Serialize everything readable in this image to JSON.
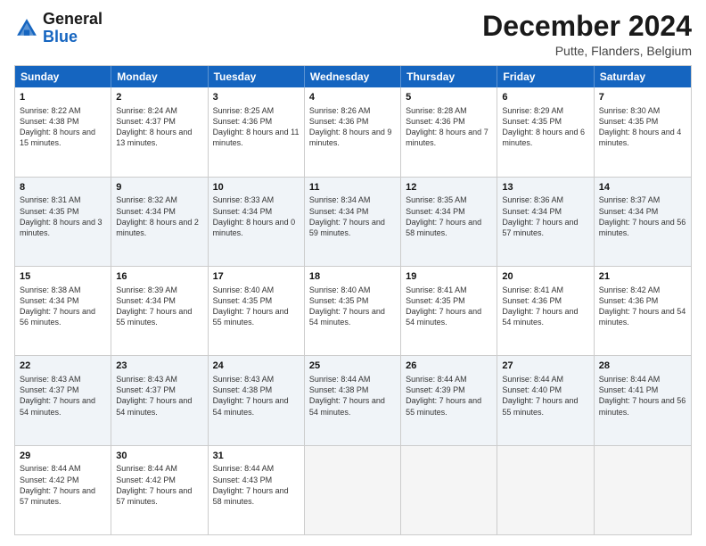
{
  "header": {
    "logo": {
      "line1": "General",
      "line2": "Blue"
    },
    "title": "December 2024",
    "subtitle": "Putte, Flanders, Belgium"
  },
  "calendar": {
    "days": [
      "Sunday",
      "Monday",
      "Tuesday",
      "Wednesday",
      "Thursday",
      "Friday",
      "Saturday"
    ],
    "rows": [
      [
        {
          "day": "1",
          "sunrise": "Sunrise: 8:22 AM",
          "sunset": "Sunset: 4:38 PM",
          "daylight": "Daylight: 8 hours and 15 minutes."
        },
        {
          "day": "2",
          "sunrise": "Sunrise: 8:24 AM",
          "sunset": "Sunset: 4:37 PM",
          "daylight": "Daylight: 8 hours and 13 minutes."
        },
        {
          "day": "3",
          "sunrise": "Sunrise: 8:25 AM",
          "sunset": "Sunset: 4:36 PM",
          "daylight": "Daylight: 8 hours and 11 minutes."
        },
        {
          "day": "4",
          "sunrise": "Sunrise: 8:26 AM",
          "sunset": "Sunset: 4:36 PM",
          "daylight": "Daylight: 8 hours and 9 minutes."
        },
        {
          "day": "5",
          "sunrise": "Sunrise: 8:28 AM",
          "sunset": "Sunset: 4:36 PM",
          "daylight": "Daylight: 8 hours and 7 minutes."
        },
        {
          "day": "6",
          "sunrise": "Sunrise: 8:29 AM",
          "sunset": "Sunset: 4:35 PM",
          "daylight": "Daylight: 8 hours and 6 minutes."
        },
        {
          "day": "7",
          "sunrise": "Sunrise: 8:30 AM",
          "sunset": "Sunset: 4:35 PM",
          "daylight": "Daylight: 8 hours and 4 minutes."
        }
      ],
      [
        {
          "day": "8",
          "sunrise": "Sunrise: 8:31 AM",
          "sunset": "Sunset: 4:35 PM",
          "daylight": "Daylight: 8 hours and 3 minutes."
        },
        {
          "day": "9",
          "sunrise": "Sunrise: 8:32 AM",
          "sunset": "Sunset: 4:34 PM",
          "daylight": "Daylight: 8 hours and 2 minutes."
        },
        {
          "day": "10",
          "sunrise": "Sunrise: 8:33 AM",
          "sunset": "Sunset: 4:34 PM",
          "daylight": "Daylight: 8 hours and 0 minutes."
        },
        {
          "day": "11",
          "sunrise": "Sunrise: 8:34 AM",
          "sunset": "Sunset: 4:34 PM",
          "daylight": "Daylight: 7 hours and 59 minutes."
        },
        {
          "day": "12",
          "sunrise": "Sunrise: 8:35 AM",
          "sunset": "Sunset: 4:34 PM",
          "daylight": "Daylight: 7 hours and 58 minutes."
        },
        {
          "day": "13",
          "sunrise": "Sunrise: 8:36 AM",
          "sunset": "Sunset: 4:34 PM",
          "daylight": "Daylight: 7 hours and 57 minutes."
        },
        {
          "day": "14",
          "sunrise": "Sunrise: 8:37 AM",
          "sunset": "Sunset: 4:34 PM",
          "daylight": "Daylight: 7 hours and 56 minutes."
        }
      ],
      [
        {
          "day": "15",
          "sunrise": "Sunrise: 8:38 AM",
          "sunset": "Sunset: 4:34 PM",
          "daylight": "Daylight: 7 hours and 56 minutes."
        },
        {
          "day": "16",
          "sunrise": "Sunrise: 8:39 AM",
          "sunset": "Sunset: 4:34 PM",
          "daylight": "Daylight: 7 hours and 55 minutes."
        },
        {
          "day": "17",
          "sunrise": "Sunrise: 8:40 AM",
          "sunset": "Sunset: 4:35 PM",
          "daylight": "Daylight: 7 hours and 55 minutes."
        },
        {
          "day": "18",
          "sunrise": "Sunrise: 8:40 AM",
          "sunset": "Sunset: 4:35 PM",
          "daylight": "Daylight: 7 hours and 54 minutes."
        },
        {
          "day": "19",
          "sunrise": "Sunrise: 8:41 AM",
          "sunset": "Sunset: 4:35 PM",
          "daylight": "Daylight: 7 hours and 54 minutes."
        },
        {
          "day": "20",
          "sunrise": "Sunrise: 8:41 AM",
          "sunset": "Sunset: 4:36 PM",
          "daylight": "Daylight: 7 hours and 54 minutes."
        },
        {
          "day": "21",
          "sunrise": "Sunrise: 8:42 AM",
          "sunset": "Sunset: 4:36 PM",
          "daylight": "Daylight: 7 hours and 54 minutes."
        }
      ],
      [
        {
          "day": "22",
          "sunrise": "Sunrise: 8:43 AM",
          "sunset": "Sunset: 4:37 PM",
          "daylight": "Daylight: 7 hours and 54 minutes."
        },
        {
          "day": "23",
          "sunrise": "Sunrise: 8:43 AM",
          "sunset": "Sunset: 4:37 PM",
          "daylight": "Daylight: 7 hours and 54 minutes."
        },
        {
          "day": "24",
          "sunrise": "Sunrise: 8:43 AM",
          "sunset": "Sunset: 4:38 PM",
          "daylight": "Daylight: 7 hours and 54 minutes."
        },
        {
          "day": "25",
          "sunrise": "Sunrise: 8:44 AM",
          "sunset": "Sunset: 4:38 PM",
          "daylight": "Daylight: 7 hours and 54 minutes."
        },
        {
          "day": "26",
          "sunrise": "Sunrise: 8:44 AM",
          "sunset": "Sunset: 4:39 PM",
          "daylight": "Daylight: 7 hours and 55 minutes."
        },
        {
          "day": "27",
          "sunrise": "Sunrise: 8:44 AM",
          "sunset": "Sunset: 4:40 PM",
          "daylight": "Daylight: 7 hours and 55 minutes."
        },
        {
          "day": "28",
          "sunrise": "Sunrise: 8:44 AM",
          "sunset": "Sunset: 4:41 PM",
          "daylight": "Daylight: 7 hours and 56 minutes."
        }
      ],
      [
        {
          "day": "29",
          "sunrise": "Sunrise: 8:44 AM",
          "sunset": "Sunset: 4:42 PM",
          "daylight": "Daylight: 7 hours and 57 minutes."
        },
        {
          "day": "30",
          "sunrise": "Sunrise: 8:44 AM",
          "sunset": "Sunset: 4:42 PM",
          "daylight": "Daylight: 7 hours and 57 minutes."
        },
        {
          "day": "31",
          "sunrise": "Sunrise: 8:44 AM",
          "sunset": "Sunset: 4:43 PM",
          "daylight": "Daylight: 7 hours and 58 minutes."
        },
        null,
        null,
        null,
        null
      ]
    ]
  }
}
